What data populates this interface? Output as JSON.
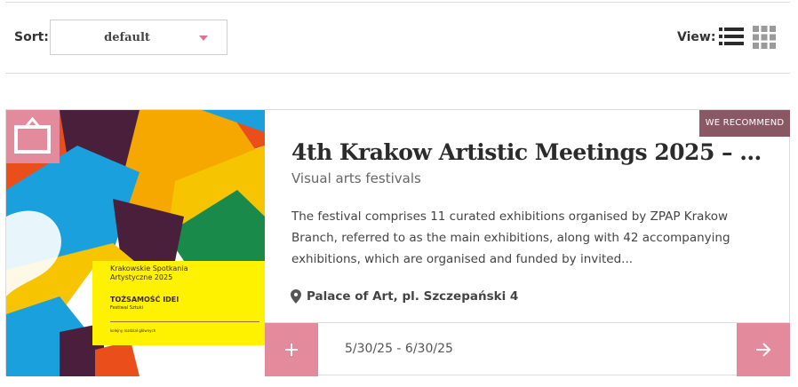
{
  "toolbar": {
    "sort_label": "Sort:",
    "sort_value": "default",
    "view_label": "View:",
    "view_options": [
      "list-view-icon",
      "grid-view-icon"
    ]
  },
  "colors": {
    "accent": "#e48a9d",
    "badge": "#8a5865",
    "text_dark": "#2b2b2b"
  },
  "card": {
    "badge": "WE RECOMMEND",
    "title": "4th Krakow Artistic Meetings 2025 – I...",
    "category": "Visual arts festivals",
    "description": "The festival comprises 11 curated exhibitions organised by ZPAP Krakow Branch, referred to as the main exhibitions, along with 42 accompanying exhibitions, which are organised and funded by invited...",
    "location": "Palace of Art, pl. Szczepański 4",
    "dates": "5/30/25 - 6/30/25",
    "image": {
      "title": "Krakowskie Spotkania Artystyczne 2025",
      "subtitle": "TOŻSAMOŚĆ IDEI",
      "festival": "Festiwal Sztuki",
      "footer": "kolejny rozdział głównych"
    }
  }
}
